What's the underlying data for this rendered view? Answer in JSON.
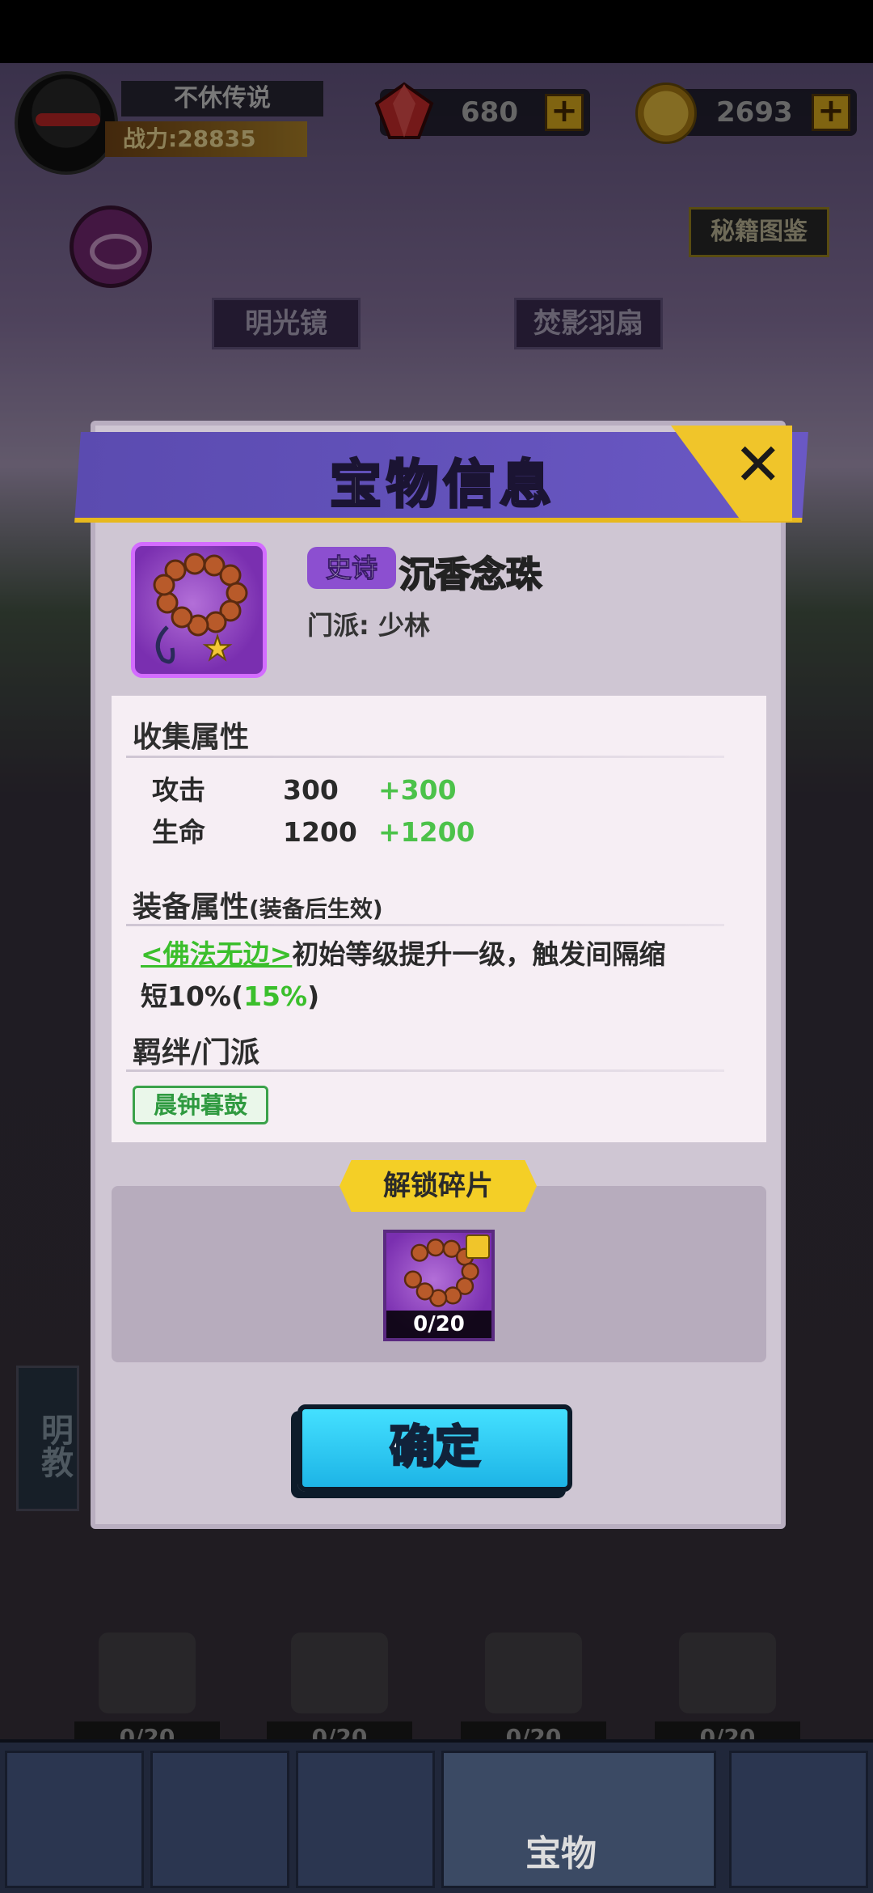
{
  "player": {
    "name": "不休传说",
    "power": "战力:28835"
  },
  "currency": {
    "gems": "680",
    "coins": "2693"
  },
  "background": {
    "secret_book": "秘籍图鉴",
    "treasures": [
      "明光镜",
      "焚影羽扇"
    ],
    "side_tag": "明教",
    "bottom_counts": [
      "0/20",
      "0/20",
      "0/20",
      "0/20"
    ],
    "nav_active_label": "宝物"
  },
  "modal": {
    "title": "宝物信息",
    "rarity": "史诗",
    "item_name": "沉香念珠",
    "sect": "门派: 少林",
    "collection_title": "收集属性",
    "stats": [
      {
        "name": "攻击",
        "value": "300",
        "bonus": "+300"
      },
      {
        "name": "生命",
        "value": "1200",
        "bonus": "+1200"
      }
    ],
    "equip_title": "装备属性",
    "equip_note": "(装备后生效)",
    "equip_skill": "<佛法无边>",
    "equip_text_1": "初始等级提升一级，触发间隔缩",
    "equip_text_2": "短10%(",
    "equip_text_3": "15%",
    "equip_text_4": ")",
    "bond_title": "羁绊/门派",
    "bond_tag": "晨钟暮鼓",
    "fragment_title": "解锁碎片",
    "fragment_count": "0/20",
    "confirm_label": "确定"
  }
}
